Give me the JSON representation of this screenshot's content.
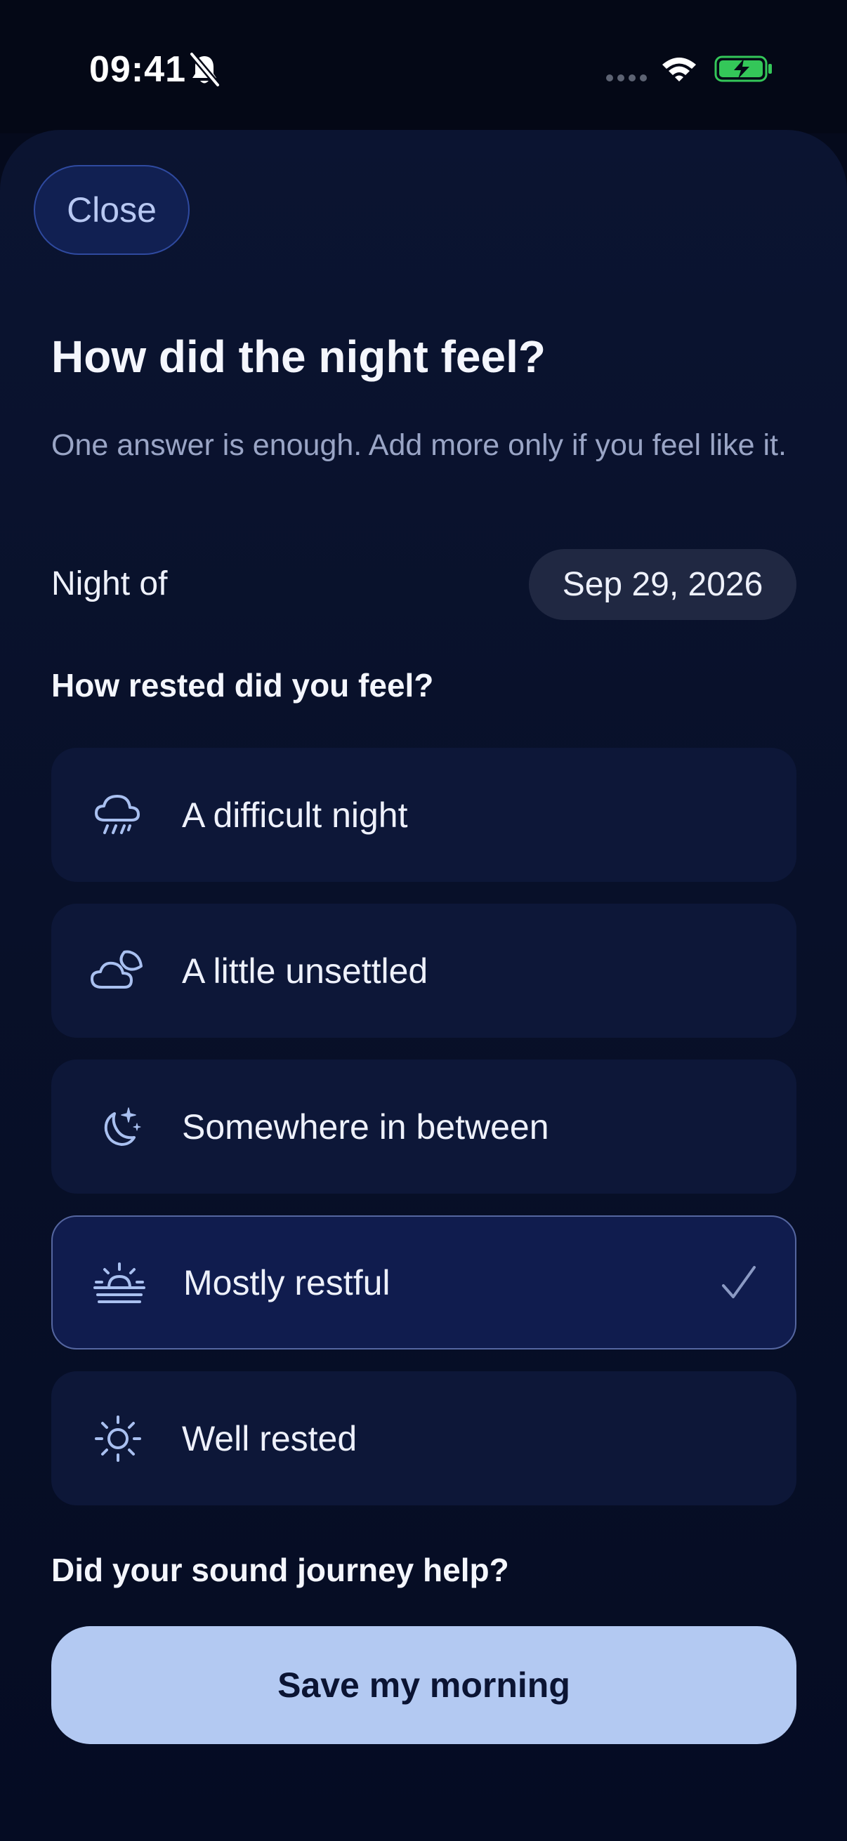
{
  "status_bar": {
    "time": "09:41",
    "icons": [
      "bell-slash-icon",
      "cellular-dots-icon",
      "wifi-icon",
      "battery-charging-icon"
    ]
  },
  "header": {
    "close_label": "Close",
    "title": "How did the night feel?",
    "subtitle": "One answer is enough. Add more only if you feel like it."
  },
  "night": {
    "label": "Night of",
    "date": "Sep 29, 2026"
  },
  "rested": {
    "heading": "How rested did you feel?",
    "options": [
      {
        "label": "A difficult night",
        "icon": "rain-cloud-icon",
        "selected": false
      },
      {
        "label": "A little unsettled",
        "icon": "cloud-moon-icon",
        "selected": false
      },
      {
        "label": "Somewhere in between",
        "icon": "moon-stars-icon",
        "selected": false
      },
      {
        "label": "Mostly restful",
        "icon": "sunrise-icon",
        "selected": true
      },
      {
        "label": "Well rested",
        "icon": "sun-icon",
        "selected": false
      }
    ]
  },
  "journey": {
    "heading": "Did your sound journey help?"
  },
  "footer": {
    "save_label": "Save my morning"
  },
  "colors": {
    "background": "#050a1c",
    "sheet": "#0b1431",
    "card": "#0d1738",
    "selected_card": "#101c4e",
    "accent": "#b3c9f2",
    "icon": "#a9c0f0",
    "battery_green": "#34c759"
  }
}
